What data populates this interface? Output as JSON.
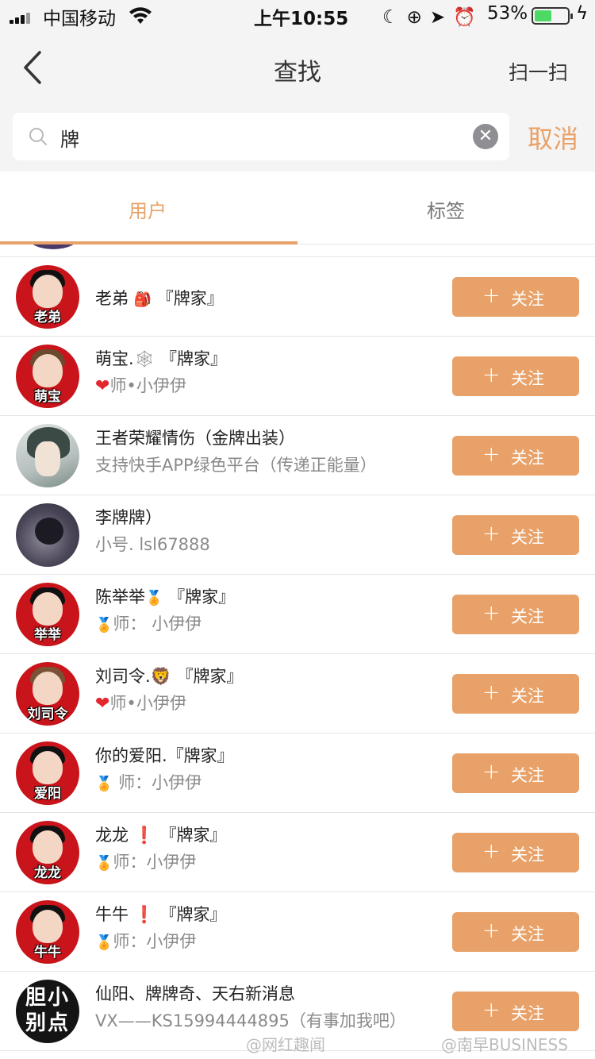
{
  "status_bar": {
    "carrier": "中国移动",
    "time": "上午10:55",
    "battery_pct": "53%",
    "battery_level": 0.53
  },
  "nav": {
    "title": "查找",
    "right_action": "扫一扫"
  },
  "search": {
    "value": "牌",
    "cancel": "取消"
  },
  "tabs": [
    {
      "label": "用户",
      "active": true
    },
    {
      "label": "标签",
      "active": false
    }
  ],
  "follow_label": "关注",
  "users": [
    {
      "name": "老弟",
      "name_suffix": "『牌家』",
      "sub": "",
      "avatar_text": "老弟"
    },
    {
      "name": "萌宝.",
      "name_suffix": "『牌家』",
      "sub_prefix": "",
      "sub": "师•小伊伊",
      "avatar_text": "萌宝"
    },
    {
      "name": "王者荣耀情伤（金牌出装）",
      "name_suffix": "",
      "sub": "支持快手APP绿色平台（传递正能量）",
      "avatar_text": ""
    },
    {
      "name": "李牌牌）",
      "name_suffix": "",
      "sub": "小号. lsl67888",
      "avatar_text": ""
    },
    {
      "name": "陈举举",
      "name_suffix": "『牌家』",
      "sub": "师：  小伊伊",
      "avatar_text": "举举"
    },
    {
      "name": "刘司令.",
      "name_suffix": "『牌家』",
      "sub": "师•小伊伊",
      "avatar_text": "刘司令"
    },
    {
      "name": "你的爱阳.",
      "name_suffix": "『牌家』",
      "sub": " 师：小伊伊",
      "avatar_text": "爱阳"
    },
    {
      "name": "龙龙",
      "name_suffix": "『牌家』",
      "sub": "师：小伊伊",
      "avatar_text": "龙龙"
    },
    {
      "name": "牛牛",
      "name_suffix": "『牌家』",
      "sub": "师：小伊伊",
      "avatar_text": "牛牛"
    },
    {
      "name": "仙阳、牌牌奇、天右新消息",
      "name_suffix": "",
      "sub": "VX——KS15994444895（有事加我吧）",
      "avatar_text_1": "胆小",
      "avatar_text_2": "别点"
    }
  ],
  "watermarks": [
    "@网红趣闻",
    "@南早BUSINESS"
  ],
  "colors": {
    "accent": "#e8a269",
    "nav_bg": "#f4f4f4",
    "avatar_red": "#c8141a"
  }
}
